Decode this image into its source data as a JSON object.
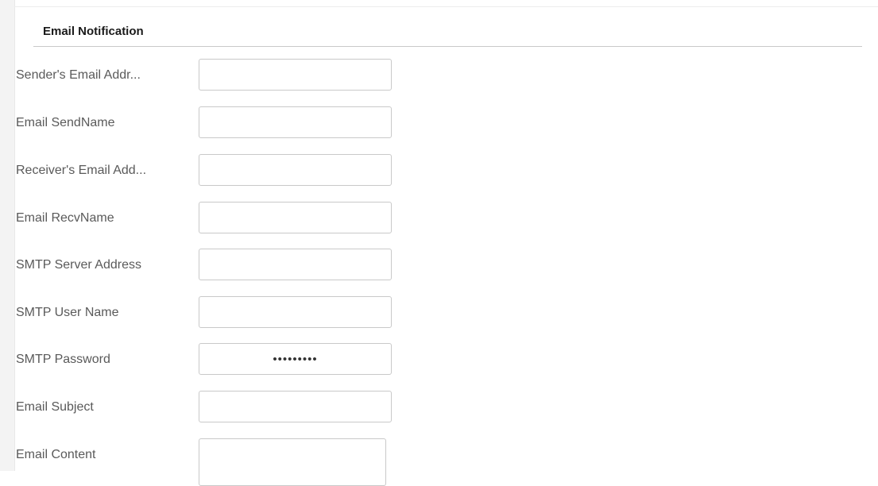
{
  "section": {
    "title": "Email Notification"
  },
  "fields": [
    {
      "label": "Sender's Email Addr...",
      "value": ""
    },
    {
      "label": "Email SendName",
      "value": ""
    },
    {
      "label": "Receiver's Email Add...",
      "value": ""
    },
    {
      "label": "Email RecvName",
      "value": ""
    },
    {
      "label": "SMTP Server Address",
      "value": ""
    },
    {
      "label": "SMTP User Name",
      "value": ""
    },
    {
      "label": "SMTP Password",
      "value": "•••••••••"
    },
    {
      "label": "Email Subject",
      "value": ""
    },
    {
      "label": "Email Content",
      "value": ""
    }
  ]
}
